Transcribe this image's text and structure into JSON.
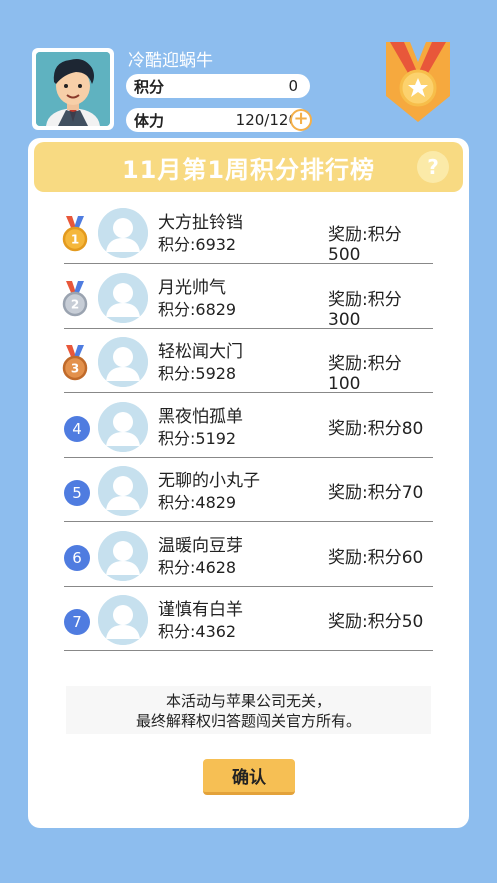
{
  "user": {
    "name": "冷酷迎蜗牛",
    "score_label": "积分",
    "score_value": "0",
    "energy_label": "体力",
    "energy_value": "120/120",
    "add_energy_icon": "plus-icon"
  },
  "leaderboard": {
    "title": "11月第1周积分排行榜",
    "help_symbol": "?",
    "rows": [
      {
        "rank": "1",
        "rank_type": "gold",
        "name": "大方扯铃铛",
        "score": "积分:6932",
        "reward": "奖励:积分500"
      },
      {
        "rank": "2",
        "rank_type": "silver",
        "name": "月光帅气",
        "score": "积分:6829",
        "reward": "奖励:积分300"
      },
      {
        "rank": "3",
        "rank_type": "bronze",
        "name": "轻松闻大门",
        "score": "积分:5928",
        "reward": "奖励:积分100"
      },
      {
        "rank": "4",
        "rank_type": "plain",
        "name": "黑夜怕孤单",
        "score": "积分:5192",
        "reward": "奖励:积分80"
      },
      {
        "rank": "5",
        "rank_type": "plain",
        "name": "无聊的小丸子",
        "score": "积分:4829",
        "reward": "奖励:积分70"
      },
      {
        "rank": "6",
        "rank_type": "plain",
        "name": "温暖向豆芽",
        "score": "积分:4628",
        "reward": "奖励:积分60"
      },
      {
        "rank": "7",
        "rank_type": "plain",
        "name": "谨慎有白羊",
        "score": "积分:4362",
        "reward": "奖励:积分50"
      }
    ],
    "disclaimer_line1": "本活动与苹果公司无关，",
    "disclaimer_line2": "最终解释权归答题闯关官方所有。",
    "confirm_label": "确认"
  },
  "colors": {
    "background": "#8dbdee",
    "title_bar": "#f8da82",
    "rank_circle": "#4f7ce0",
    "confirm_button": "#f6bf54"
  }
}
